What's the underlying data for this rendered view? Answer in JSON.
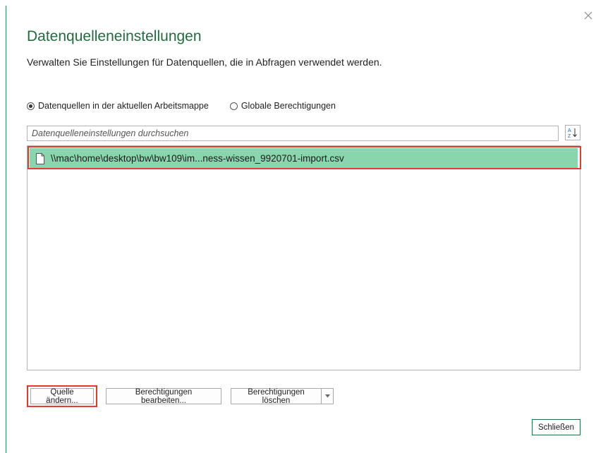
{
  "dialog": {
    "title": "Datenquelleneinstellungen",
    "subtitle": "Verwalten Sie Einstellungen für Datenquellen, die in Abfragen verwendet werden."
  },
  "scope": {
    "options": [
      {
        "label": "Datenquellen in der aktuellen Arbeitsmappe",
        "selected": true
      },
      {
        "label": "Globale Berechtigungen",
        "selected": false
      }
    ]
  },
  "search": {
    "placeholder": "Datenquelleneinstellungen durchsuchen",
    "value": ""
  },
  "sources": {
    "items": [
      {
        "label": "\\\\mac\\home\\desktop\\bw\\bw109\\im...ness-wissen_9920701-import.csv",
        "selected": true,
        "icon": "file-icon"
      }
    ]
  },
  "buttons": {
    "change_source": "Quelle ändern...",
    "edit_permissions": "Berechtigungen bearbeiten...",
    "delete_permissions": "Berechtigungen löschen",
    "close": "Schließen"
  },
  "icons": {
    "close": "close-icon",
    "sort": "sort-az-icon",
    "dropdown": "chevron-down-icon"
  },
  "colors": {
    "accent": "#217346",
    "title": "#216c3f",
    "selected_row": "#89d6ae",
    "highlight": "#e63a2e"
  }
}
